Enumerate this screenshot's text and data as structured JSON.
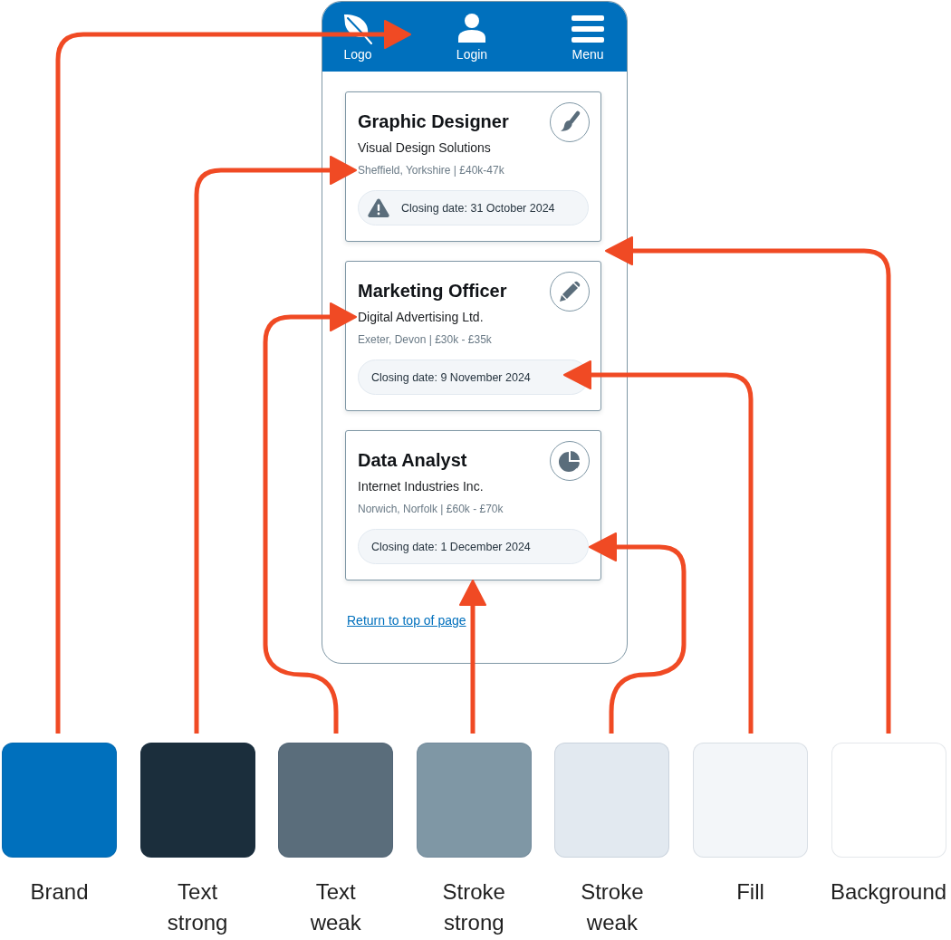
{
  "phone": {
    "header": {
      "items": [
        {
          "kind": "logo",
          "label": "Logo"
        },
        {
          "kind": "login",
          "label": "Login"
        },
        {
          "kind": "menu",
          "label": "Menu"
        }
      ]
    },
    "jobs": [
      {
        "title": "Graphic Designer",
        "company": "Visual Design Solutions",
        "details": "Sheffield, Yorkshire | £40k-47k",
        "kind": "brush",
        "closing_date": "Closing date: 31 October 2024",
        "warning": true
      },
      {
        "title": "Marketing Officer",
        "company": "Digital Advertising Ltd.",
        "details": "Exeter, Devon | £30k - £35k",
        "kind": "pencil",
        "closing_date": "Closing date: 9 November 2024",
        "warning": false
      },
      {
        "title": "Data Analyst",
        "company": "Internet Industries Inc.",
        "details": "Norwich, Norfolk | £60k - £70k",
        "kind": "pie",
        "closing_date": "Closing date: 1 December 2024",
        "warning": false
      }
    ],
    "return_link": "Return to top of page"
  },
  "swatches": [
    {
      "label": "Brand",
      "color": "#0070bd"
    },
    {
      "label": "Text strong",
      "color": "#1b2e3c"
    },
    {
      "label": "Text weak",
      "color": "#5a6d7b"
    },
    {
      "label": "Stroke strong",
      "color": "#7f97a5"
    },
    {
      "label": "Stroke weak",
      "color": "#e2e9f0"
    },
    {
      "label": "Fill",
      "color": "#f3f6f9"
    },
    {
      "label": "Background",
      "color": "#ffffff"
    }
  ]
}
